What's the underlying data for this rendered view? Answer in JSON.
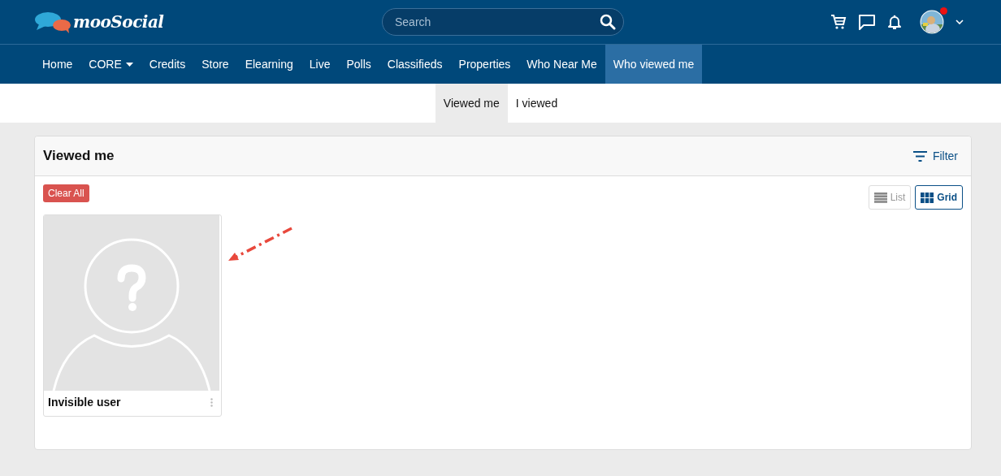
{
  "header": {
    "logo": "mooSocial",
    "search": {
      "placeholder": "Search"
    },
    "notification_dot": true
  },
  "nav": [
    {
      "label": "Home",
      "selected": false,
      "dropdown": false
    },
    {
      "label": "CORE",
      "selected": false,
      "dropdown": true
    },
    {
      "label": "Credits",
      "selected": false,
      "dropdown": false
    },
    {
      "label": "Store",
      "selected": false,
      "dropdown": false
    },
    {
      "label": "Elearning",
      "selected": false,
      "dropdown": false
    },
    {
      "label": "Live",
      "selected": false,
      "dropdown": false
    },
    {
      "label": "Polls",
      "selected": false,
      "dropdown": false
    },
    {
      "label": "Classifieds",
      "selected": false,
      "dropdown": false
    },
    {
      "label": "Properties",
      "selected": false,
      "dropdown": false
    },
    {
      "label": "Who Near Me",
      "selected": false,
      "dropdown": false
    },
    {
      "label": "Who viewed me",
      "selected": true,
      "dropdown": false
    }
  ],
  "subtabs": [
    {
      "label": "Viewed me",
      "selected": true
    },
    {
      "label": "I viewed",
      "selected": false
    }
  ],
  "panel": {
    "title": "Viewed me",
    "filter": "Filter",
    "clear_button": "Clear All",
    "views": [
      {
        "label": "List",
        "selected": false,
        "kind": "list"
      },
      {
        "label": "Grid",
        "selected": true,
        "kind": "grid"
      }
    ],
    "users": [
      {
        "name": "Invisible user"
      }
    ]
  }
}
